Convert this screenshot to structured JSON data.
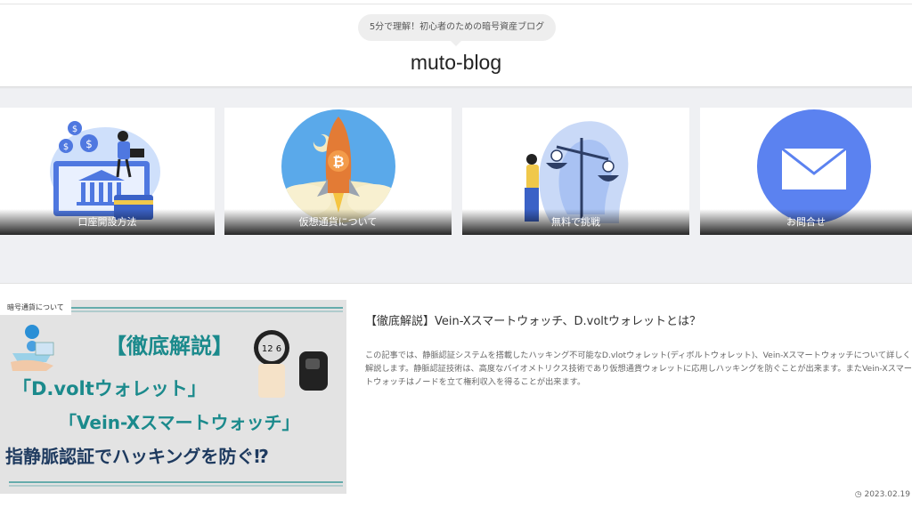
{
  "header": {
    "tagline": "5分で理解！初心者のための暗号資産ブログ",
    "site_title": "muto-blog"
  },
  "nav_cards": [
    {
      "label": "口座開設方法",
      "icon": "bank-laptop-illustration"
    },
    {
      "label": "仮想通貨について",
      "icon": "bitcoin-rocket-illustration"
    },
    {
      "label": "無料で挑戦",
      "icon": "scale-brain-illustration"
    },
    {
      "label": "お問合せ",
      "icon": "mail-icon"
    }
  ],
  "post": {
    "category": "暗号通貨について",
    "thumbnail": {
      "line1": "【徹底解説】",
      "line2": "「D.voltウォレット」",
      "line3": "「Vein-Xスマートウォッチ」",
      "line4": "指静脈認証でハッキングを防ぐ⁉"
    },
    "title": "【徹底解説】Vein-Xスマートウォッチ、D.voltウォレットとは？",
    "excerpt": "この記事では、静脈認証システムを搭載したハッキング不可能なD.vlotウォレット(ディボルトウォレット)、Vein-Xスマートウォッチについて詳しく解説します。静脈認証技術は、高度なバイオメトリクス技術であり仮想通貨ウォレットに応用しハッキングを防ぐことが出来ます。またVein-Xスマートウォッチはノードを立て権利収入を得ることが出来ます。",
    "date_icon": "clock-icon",
    "date": "2023.02.19"
  },
  "colors": {
    "nav_background": "#eff0f3",
    "mail_circle": "#5b82f0",
    "thumb_title_teal": "#1b8a8c",
    "thumb_title_dark": "#1e3a5f"
  }
}
